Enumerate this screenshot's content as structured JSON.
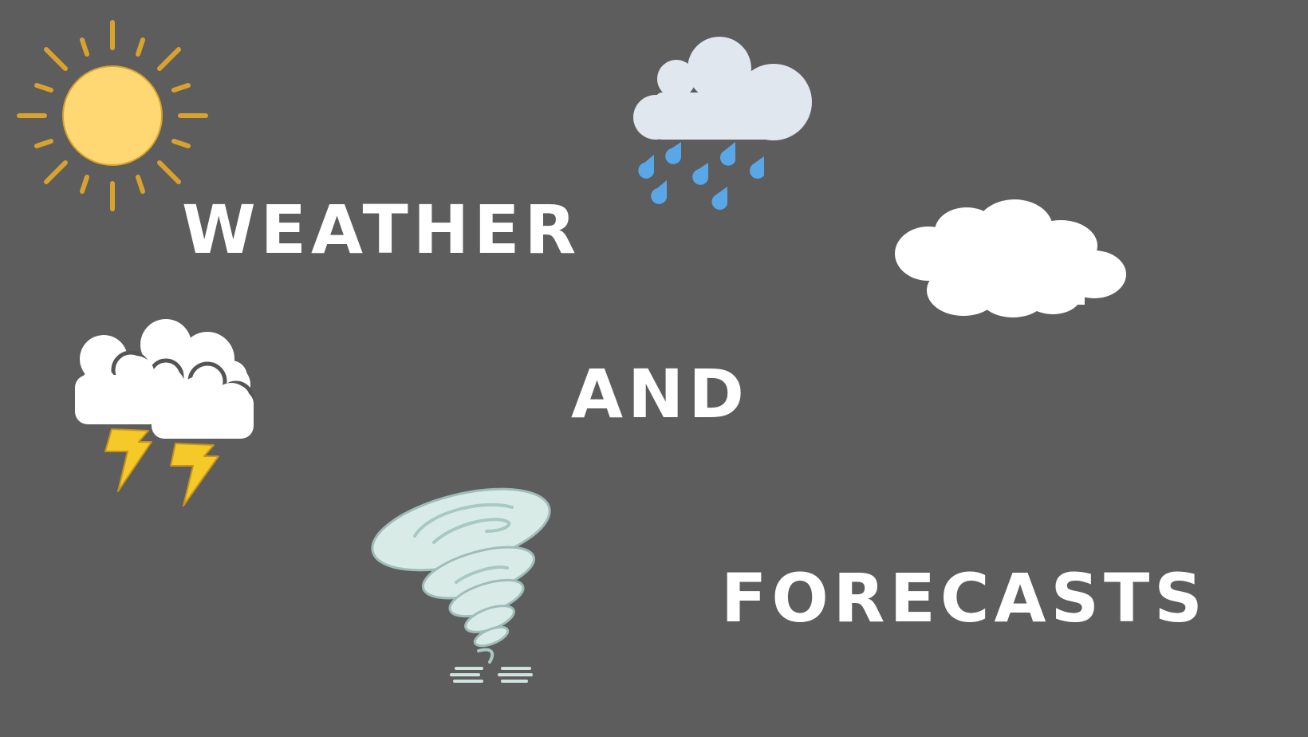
{
  "words": {
    "weather": "WEATHER",
    "and": "AND",
    "forecasts": "FORECASTS"
  },
  "colors": {
    "background": "#5d5d5d",
    "text": "#ffffff",
    "sun_body": "#ffd873",
    "sun_rays": "#d9a22e",
    "rain_cloud": "#e1e7ee",
    "raindrop": "#5aa7e8",
    "cloud": "#ffffff",
    "lightning": "#f4c928",
    "tornado": "#cfe3df"
  },
  "icons": [
    "sun-icon",
    "rain-cloud-icon",
    "cloud-icon",
    "thunderstorm-icon",
    "tornado-icon"
  ]
}
